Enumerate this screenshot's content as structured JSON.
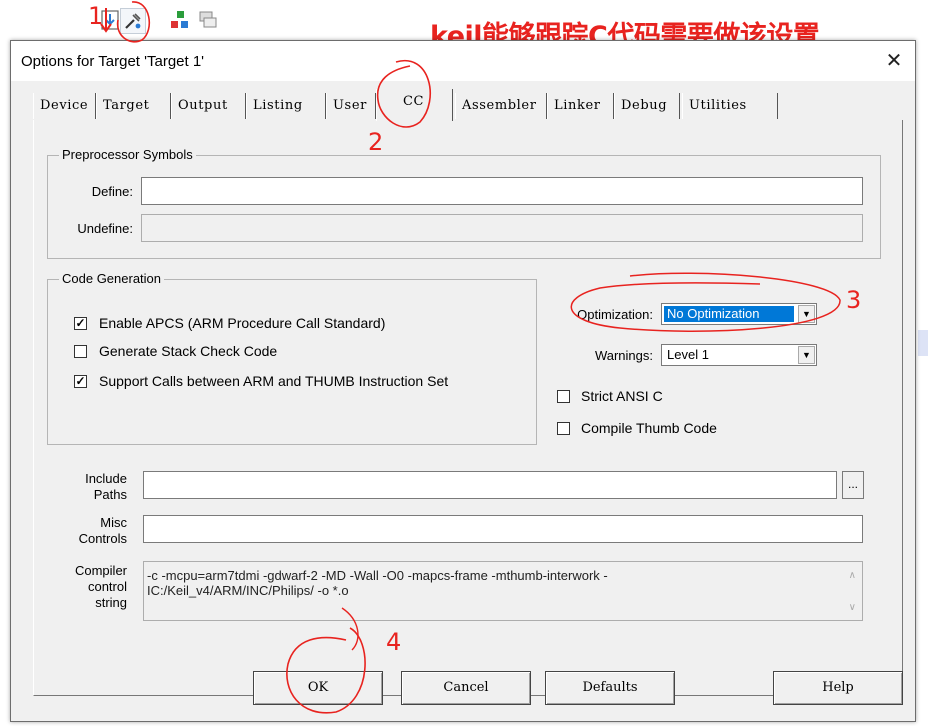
{
  "annotation": {
    "headline": "keil能够跟踪C代码需要做该设置",
    "steps": [
      "1",
      "2",
      "3",
      "4"
    ]
  },
  "toolbar": {
    "icons": [
      "target-options-icon",
      "component-icon",
      "window-icon"
    ]
  },
  "dialog": {
    "title": "Options for Target 'Target 1'",
    "close_label": "✕",
    "tabs": [
      "Device",
      "Target",
      "Output",
      "Listing",
      "User",
      "CC",
      "Assembler",
      "Linker",
      "Debug",
      "Utilities"
    ],
    "active_tab": "CC",
    "preprocessor": {
      "legend": "Preprocessor Symbols",
      "define_label": "Define:",
      "define_value": "",
      "undefine_label": "Undefine:",
      "undefine_value": ""
    },
    "code_generation": {
      "legend": "Code Generation",
      "options": [
        {
          "label": "Enable APCS (ARM Procedure Call Standard)",
          "checked": true
        },
        {
          "label": "Generate Stack Check Code",
          "checked": false
        },
        {
          "label": "Support Calls between ARM and THUMB Instruction Set",
          "checked": true
        }
      ]
    },
    "optimization": {
      "label": "Optimization:",
      "value": "No Optimization"
    },
    "warnings": {
      "label": "Warnings:",
      "value": "Level 1"
    },
    "strict_ansi": {
      "label": "Strict ANSI C",
      "checked": false
    },
    "compile_thumb": {
      "label": "Compile Thumb Code",
      "checked": false
    },
    "include_paths": {
      "label_line1": "Include",
      "label_line2": "Paths",
      "value": "",
      "browse_label": "..."
    },
    "misc_controls": {
      "label_line1": "Misc",
      "label_line2": "Controls",
      "value": ""
    },
    "compiler_control": {
      "label_line1": "Compiler",
      "label_line2": "control",
      "label_line3": "string",
      "line1": "-c -mcpu=arm7tdmi -gdwarf-2 -MD -Wall -O0 -mapcs-frame -mthumb-interwork -",
      "line2": "IC:/Keil_v4/ARM/INC/Philips/ -o *.o"
    },
    "buttons": {
      "ok": "OK",
      "cancel": "Cancel",
      "defaults": "Defaults",
      "help": "Help"
    }
  },
  "colors": {
    "annotation_red": "#e8231f",
    "selection_blue": "#0078d7"
  }
}
